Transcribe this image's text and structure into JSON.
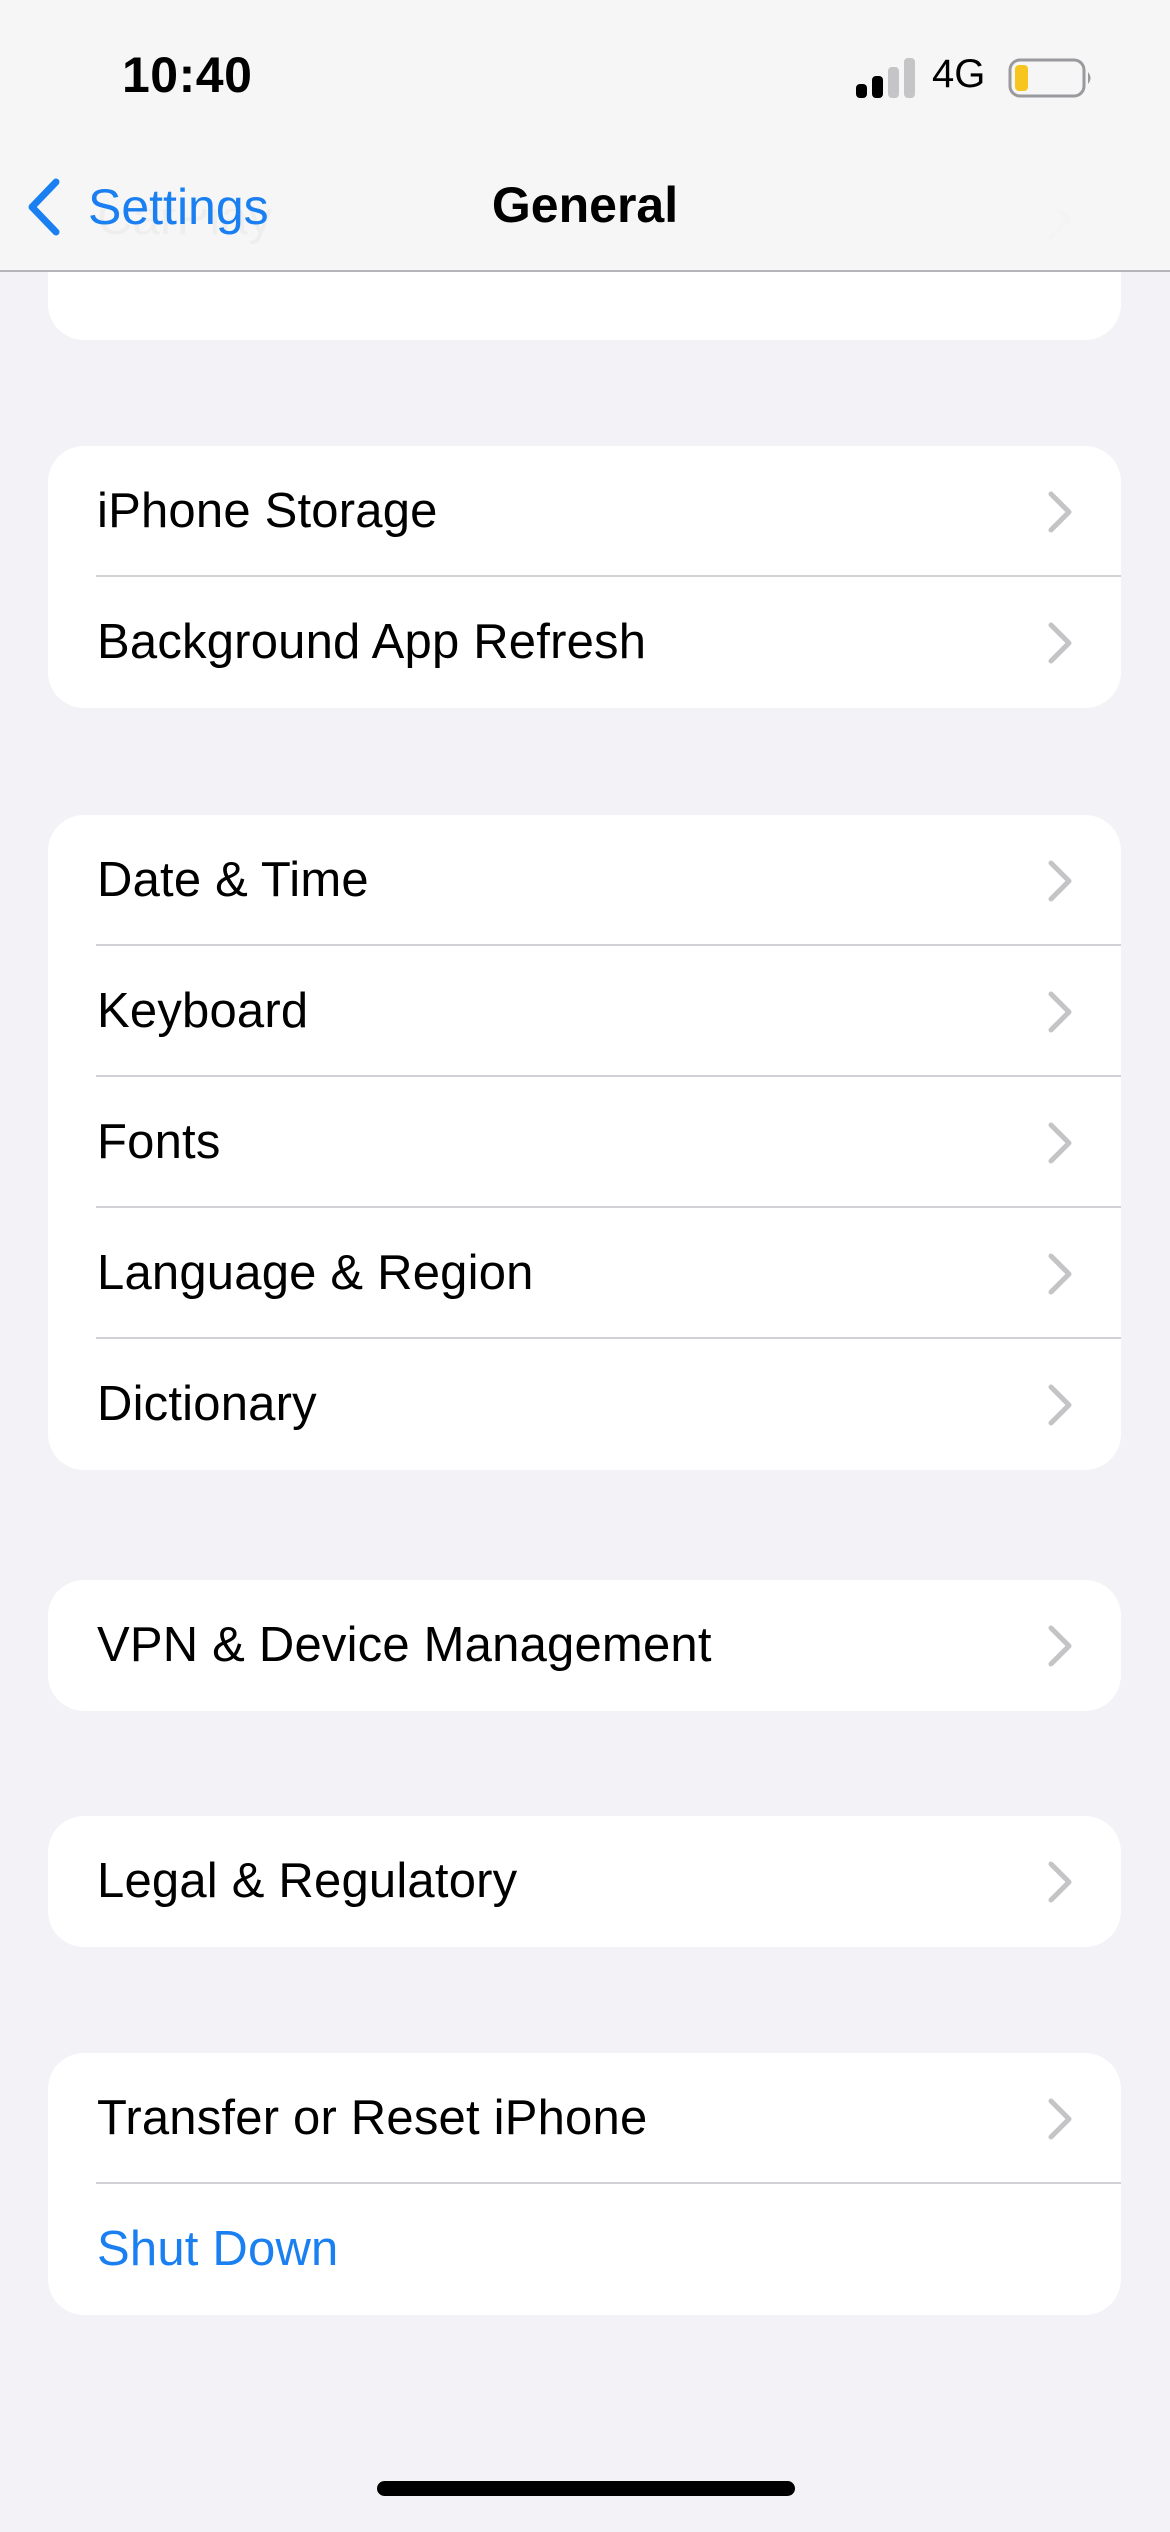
{
  "status_bar": {
    "time": "10:40",
    "signal_bars_filled": 2,
    "signal_bars_total": 4,
    "network": "4G",
    "battery_level_percent": 20,
    "battery_color": "#f7c51e"
  },
  "nav": {
    "back_label": "Settings",
    "title": "General",
    "accent_color": "#1a7ff0"
  },
  "groups": [
    {
      "rows": [
        {
          "label": "CarPlay",
          "chevron": true
        }
      ]
    },
    {
      "rows": [
        {
          "label": "iPhone Storage",
          "chevron": true
        },
        {
          "label": "Background App Refresh",
          "chevron": true
        }
      ]
    },
    {
      "rows": [
        {
          "label": "Date & Time",
          "chevron": true
        },
        {
          "label": "Keyboard",
          "chevron": true
        },
        {
          "label": "Fonts",
          "chevron": true
        },
        {
          "label": "Language & Region",
          "chevron": true
        },
        {
          "label": "Dictionary",
          "chevron": true
        }
      ]
    },
    {
      "rows": [
        {
          "label": "VPN & Device Management",
          "chevron": true
        }
      ]
    },
    {
      "rows": [
        {
          "label": "Legal & Regulatory",
          "chevron": true
        }
      ]
    },
    {
      "rows": [
        {
          "label": "Transfer or Reset iPhone",
          "chevron": true
        },
        {
          "label": "Shut Down",
          "chevron": false,
          "style": "blue"
        }
      ]
    }
  ]
}
